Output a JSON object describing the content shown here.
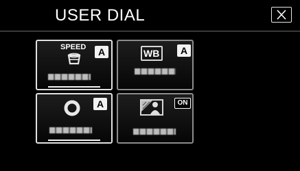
{
  "header": {
    "title": "USER DIAL"
  },
  "tiles": [
    {
      "id": "speed",
      "icon_text": "SPEED",
      "badge": "A",
      "icon": "zoom-speed-icon",
      "selected": true
    },
    {
      "id": "white-balance",
      "icon_text": "WB",
      "badge": "A",
      "icon": "white-balance-icon",
      "selected": false
    },
    {
      "id": "focus",
      "badge": "A",
      "icon": "focus-ring-icon",
      "selected": true
    },
    {
      "id": "backlight",
      "badge": "ON",
      "icon": "backlight-icon",
      "selected": false
    }
  ],
  "colors": {
    "background": "#000000",
    "tile_border": "#8c8c8c",
    "text": "#ffffff"
  }
}
